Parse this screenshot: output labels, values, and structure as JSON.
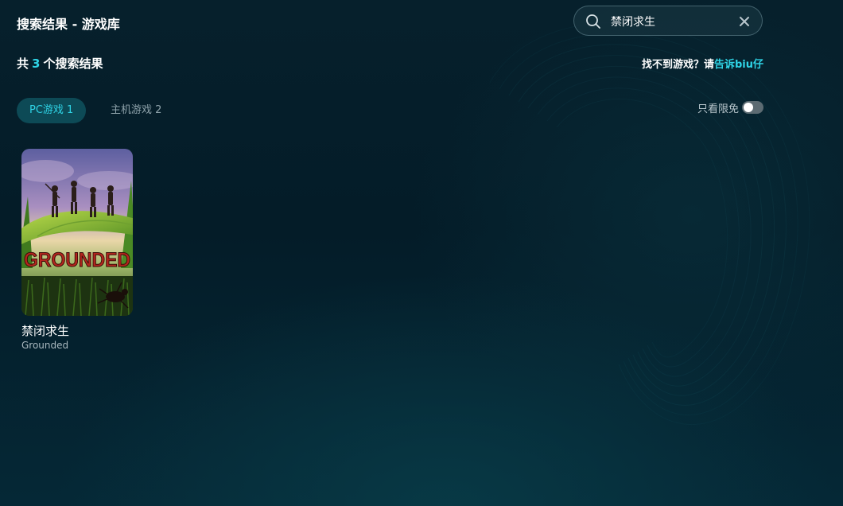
{
  "header": {
    "title": "搜索结果 - 游戏库"
  },
  "search": {
    "query": "禁闭求生",
    "icon": "search-icon",
    "clear_icon": "close-icon"
  },
  "results": {
    "prefix": "共",
    "count": "3",
    "suffix": "个搜索结果"
  },
  "feedback": {
    "text": "找不到游戏？请",
    "link": "告诉biu仔"
  },
  "tabs": [
    {
      "label": "PC游戏 1",
      "active": true
    },
    {
      "label": "主机游戏 2",
      "active": false
    }
  ],
  "filter": {
    "label": "只看限免",
    "enabled": false
  },
  "games": [
    {
      "title": "禁闭求生",
      "subtitle": "Grounded",
      "cover_text": "GROUNDED"
    }
  ],
  "colors": {
    "accent": "#2fd4e6",
    "background": "#041c28",
    "tab_active_bg": "#0d4a56",
    "muted_text": "#8fa3ab"
  }
}
